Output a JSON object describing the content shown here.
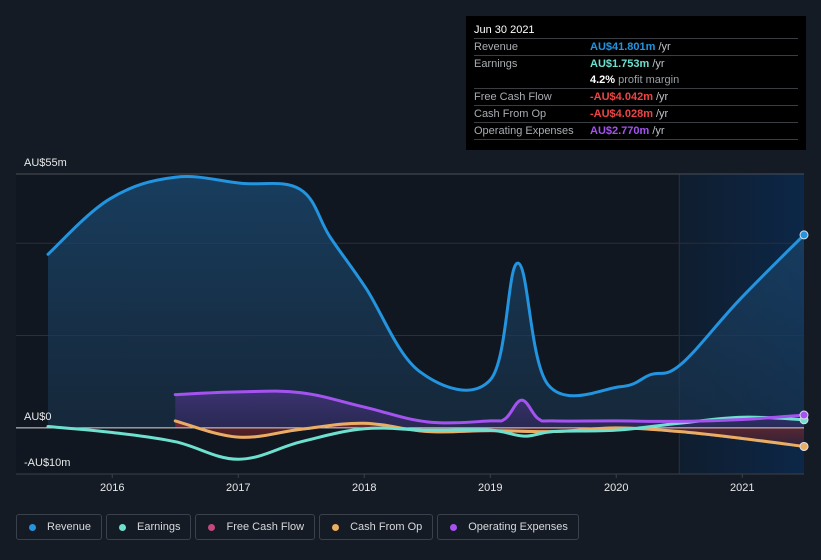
{
  "tooltip": {
    "date": "Jun 30 2021",
    "rows": [
      {
        "label": "Revenue",
        "value": "AU$41.801m",
        "unit": "/yr",
        "color": "#2394df"
      },
      {
        "label": "Earnings",
        "value": "AU$1.753m",
        "unit": "/yr",
        "color": "#6ee0cf"
      },
      {
        "label": "",
        "value": "4.2%",
        "unit": "profit margin",
        "color": "#ffffff"
      },
      {
        "label": "Free Cash Flow",
        "value": "-AU$4.042m",
        "unit": "/yr",
        "color": "#ef4444"
      },
      {
        "label": "Cash From Op",
        "value": "-AU$4.028m",
        "unit": "/yr",
        "color": "#ef4444"
      },
      {
        "label": "Operating Expenses",
        "value": "AU$2.770m",
        "unit": "/yr",
        "color": "#a553f0"
      }
    ]
  },
  "legend": [
    {
      "label": "Revenue",
      "color": "#2394df"
    },
    {
      "label": "Earnings",
      "color": "#6ee0cf"
    },
    {
      "label": "Free Cash Flow",
      "color": "#c2497e"
    },
    {
      "label": "Cash From Op",
      "color": "#eaad64"
    },
    {
      "label": "Operating Expenses",
      "color": "#a553f0"
    }
  ],
  "chart_data": {
    "type": "area",
    "title": "",
    "xlabel": "",
    "ylabel": "",
    "currency": "AUD",
    "ylim": [
      -10,
      55
    ],
    "xlim": [
      2015.49,
      2021.49
    ],
    "y_tick_labels": [
      {
        "value": 55,
        "label": "AU$55m"
      },
      {
        "value": 0,
        "label": "AU$0"
      },
      {
        "value": -10,
        "label": "-AU$10m"
      }
    ],
    "gridlines": [
      20,
      40,
      55
    ],
    "x_ticks": [
      {
        "value": 2016,
        "label": "2016"
      },
      {
        "value": 2017,
        "label": "2017"
      },
      {
        "value": 2018,
        "label": "2018"
      },
      {
        "value": 2019,
        "label": "2019"
      },
      {
        "value": 2020,
        "label": "2020"
      },
      {
        "value": 2021,
        "label": "2021"
      }
    ],
    "highlight_range": [
      2020.5,
      2021.49
    ],
    "legend_position": "bottom",
    "series": [
      {
        "name": "Revenue",
        "color": "#2394df",
        "fill": true,
        "x": [
          2015.49,
          2015.98,
          2016.5,
          2017.02,
          2017.49,
          2017.73,
          2018.01,
          2018.44,
          2019.0,
          2019.22,
          2019.46,
          2020.03,
          2020.27,
          2020.51,
          2020.98,
          2021.49
        ],
        "values": [
          37.6,
          49.6,
          54.3,
          53.0,
          51.7,
          41.3,
          30.4,
          12.2,
          10.4,
          35.7,
          9.3,
          8.9,
          11.5,
          13.7,
          27.8,
          41.8
        ]
      },
      {
        "name": "Earnings",
        "color": "#6ee0cf",
        "fill": false,
        "x": [
          2015.49,
          2016.0,
          2016.5,
          2017.0,
          2017.5,
          2018.0,
          2018.5,
          2019.0,
          2019.27,
          2019.5,
          2020.0,
          2020.5,
          2021.0,
          2021.49
        ],
        "values": [
          0.3,
          -1.0,
          -3.0,
          -6.8,
          -3.0,
          -0.2,
          -0.5,
          -0.5,
          -1.8,
          -0.8,
          -0.5,
          1.0,
          2.3,
          1.75
        ]
      },
      {
        "name": "Free Cash Flow",
        "color": "#c2497e",
        "fill": true,
        "x": [
          2016.5,
          2017.0,
          2017.5,
          2018.0,
          2018.5,
          2019.0,
          2019.5,
          2020.0,
          2020.5,
          2021.0,
          2021.49
        ],
        "values": [
          1.4,
          -2.1,
          -0.4,
          0.9,
          -0.9,
          -0.7,
          -0.9,
          -0.1,
          -0.9,
          -2.4,
          -4.04
        ]
      },
      {
        "name": "Cash From Op",
        "color": "#eaad64",
        "fill": false,
        "x": [
          2016.5,
          2017.0,
          2017.5,
          2018.0,
          2018.5,
          2019.0,
          2019.5,
          2020.0,
          2020.5,
          2021.0,
          2021.49
        ],
        "values": [
          1.5,
          -2.0,
          -0.3,
          1.0,
          -0.8,
          -0.6,
          -0.8,
          0.0,
          -0.8,
          -2.3,
          -4.03
        ]
      },
      {
        "name": "Operating Expenses",
        "color": "#a553f0",
        "fill": true,
        "x": [
          2016.5,
          2017.0,
          2017.5,
          2018.0,
          2018.5,
          2019.0,
          2019.12,
          2019.25,
          2019.38,
          2019.5,
          2020.0,
          2020.5,
          2021.0,
          2021.49
        ],
        "values": [
          7.2,
          7.8,
          7.6,
          4.5,
          1.3,
          1.5,
          2.0,
          6.0,
          2.0,
          1.5,
          1.5,
          1.4,
          1.8,
          2.77
        ]
      }
    ]
  }
}
